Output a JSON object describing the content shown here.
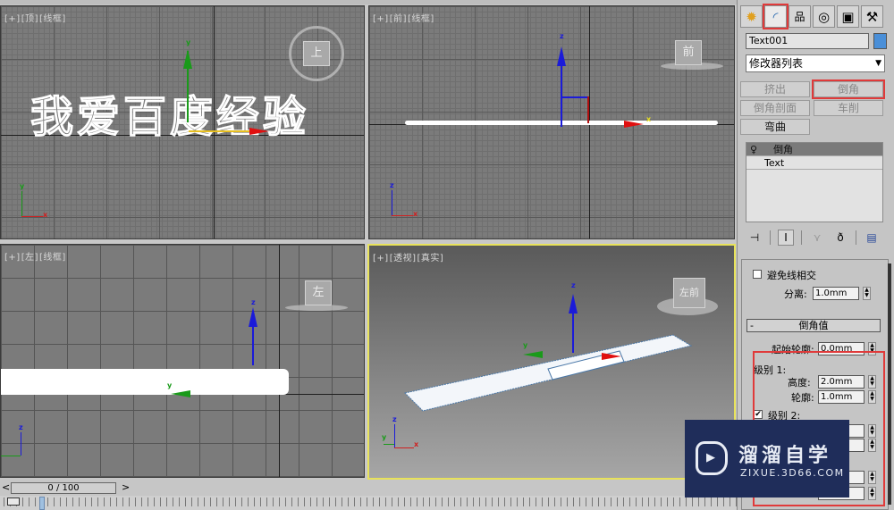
{
  "viewports": {
    "top": {
      "label_plus": "[+]",
      "label_view": "[顶]",
      "label_shade": "[线框]",
      "cube_face": "上",
      "text": "我爱百度经验"
    },
    "front": {
      "label_plus": "[+]",
      "label_view": "[前]",
      "label_shade": "[线框]",
      "cube_face": "前"
    },
    "left": {
      "label_plus": "[+]",
      "label_view": "[左]",
      "label_shade": "[线框]",
      "cube_face": "左"
    },
    "perspective": {
      "label_plus": "[+]",
      "label_view": "[透视]",
      "label_shade": "[真实]",
      "cube_face": "左前"
    }
  },
  "axes": {
    "x": "x",
    "y": "y",
    "z": "z"
  },
  "panel": {
    "tabs": [
      {
        "name": "create",
        "icon": "✹"
      },
      {
        "name": "modify",
        "icon": "◜"
      },
      {
        "name": "hierarchy",
        "icon": "品"
      },
      {
        "name": "motion",
        "icon": "◎"
      },
      {
        "name": "display",
        "icon": "▣"
      },
      {
        "name": "utilities",
        "icon": "⚒"
      }
    ],
    "object_name": "Text001",
    "object_color": "#4a8fd8",
    "modifier_list": "修改器列表",
    "modifier_buttons": [
      {
        "label": "挤出",
        "enabled": false
      },
      {
        "label": "倒角",
        "enabled": false,
        "highlighted": true
      },
      {
        "label": "倒角剖面",
        "enabled": false
      },
      {
        "label": "车削",
        "enabled": false
      },
      {
        "label": "弯曲",
        "enabled": true
      }
    ],
    "stack": [
      {
        "label": "倒角",
        "selected": true,
        "icon": "lightbulb"
      },
      {
        "label": "Text",
        "selected": false
      }
    ],
    "stack_tools": [
      "pin-stack",
      "show-end-result",
      "make-unique",
      "remove-modifier",
      "configure-sets"
    ],
    "avoid_intersect": {
      "label": "避免线相交",
      "checked": false
    },
    "separation": {
      "label": "分离:",
      "value": "1.0mm"
    },
    "bevel_values": {
      "header": "倒角值",
      "start_outline": {
        "label": "起始轮廓:",
        "value": "0.0mm"
      },
      "level1": {
        "label": "级别 1:",
        "height": {
          "label": "高度:",
          "value": "2.0mm"
        },
        "outline": {
          "label": "轮廓:",
          "value": "1.0mm"
        }
      },
      "level2": {
        "label": "级别 2:",
        "checked": true
      }
    }
  },
  "timeline": {
    "prev": "<",
    "next": ">",
    "frame": "0 / 100"
  },
  "watermark": {
    "title": "溜溜自学",
    "url": "ZIXUE.3D66.COM"
  }
}
